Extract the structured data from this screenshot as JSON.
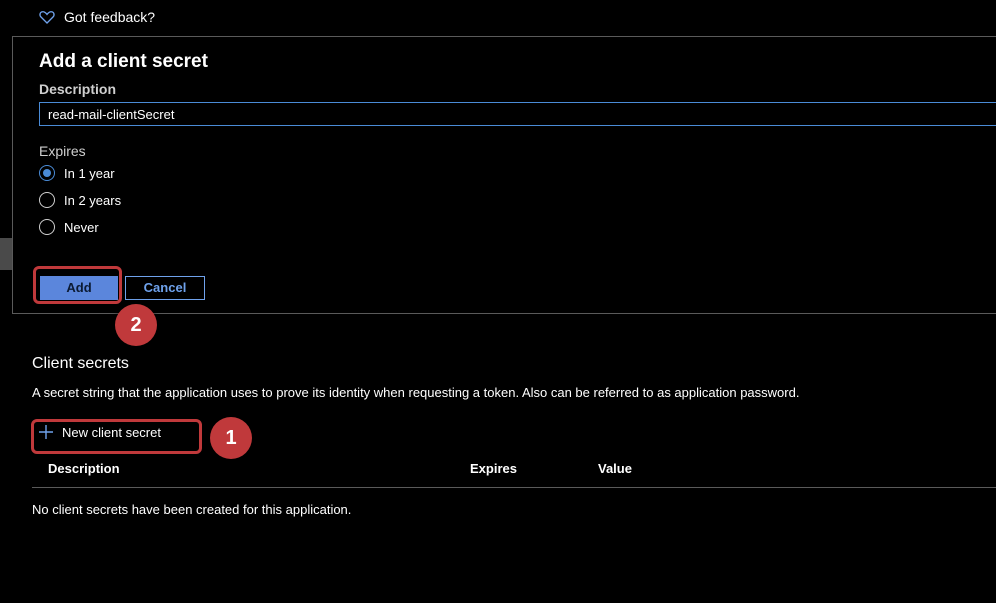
{
  "feedback": {
    "label": "Got feedback?",
    "icon": "heart-icon"
  },
  "panel": {
    "title": "Add a client secret",
    "description_label": "Description",
    "description_value": "read-mail-clientSecret",
    "expires_label": "Expires",
    "options": [
      "In 1 year",
      "In 2 years",
      "Never"
    ],
    "selected_option": "In 1 year",
    "add_label": "Add",
    "cancel_label": "Cancel"
  },
  "client_secrets": {
    "title": "Client secrets",
    "description": "A secret string that the application uses to prove its identity when requesting a token. Also can be referred to as application password.",
    "new_button_label": "New client secret",
    "columns": [
      "Description",
      "Expires",
      "Value"
    ],
    "empty_message": "No client secrets have been created for this application."
  },
  "annotations": {
    "step1": "1",
    "step2": "2"
  },
  "colors": {
    "accent": "#4a8bd6",
    "primary_button": "#5b86dc",
    "highlight": "#c0393b",
    "background": "#000000"
  }
}
